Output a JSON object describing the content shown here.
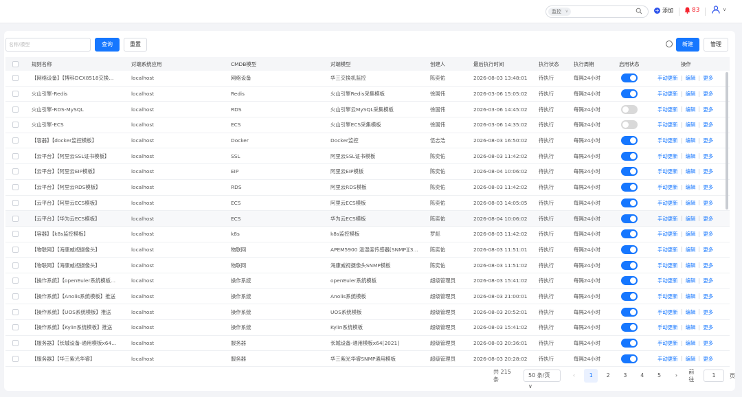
{
  "topbar": {
    "search_select": "监控",
    "add_label": "添加",
    "notification_count": "83"
  },
  "toolbar": {
    "name_placeholder": "名称/模型",
    "query_label": "查询",
    "reset_label": "重置",
    "new_label": "新建",
    "manage_label": "管理"
  },
  "columns": [
    "规则名称",
    "对端系统应用",
    "CMDB模型",
    "对端模型",
    "创建人",
    "最后执行时间",
    "执行状态",
    "执行周期",
    "启用状态",
    "操作"
  ],
  "ops": {
    "update": "手动更新",
    "edit": "编辑",
    "more": "更多"
  },
  "rows": [
    {
      "name": "【网络设备】【博科DCX8518交换...",
      "app": "localhost",
      "cmdb": "网络设备",
      "model": "华三交换机监控",
      "creator": "陈奕佑",
      "time": "2026-08-03 13:48:01",
      "status": "待执行",
      "cycle": "每隔24小时",
      "enabled": true
    },
    {
      "name": "火山引擎-Redis",
      "app": "localhost",
      "cmdb": "Redis",
      "model": "火山引擎Redis采集模板",
      "creator": "徐国伟",
      "time": "2026-03-06 15:05:02",
      "status": "待执行",
      "cycle": "每隔24小时",
      "enabled": true
    },
    {
      "name": "火山引擎-RDS-MySQL",
      "app": "localhost",
      "cmdb": "RDS",
      "model": "火山引擎云MySQL采集模板",
      "creator": "徐国伟",
      "time": "2026-03-06 14:45:02",
      "status": "待执行",
      "cycle": "每隔24小时",
      "enabled": false
    },
    {
      "name": "火山引擎-ECS",
      "app": "localhost",
      "cmdb": "ECS",
      "model": "火山引擎ECS采集模板",
      "creator": "徐国伟",
      "time": "2026-03-06 14:35:02",
      "status": "待执行",
      "cycle": "每隔24小时",
      "enabled": false
    },
    {
      "name": "【容器】【docker监控模板】",
      "app": "localhost",
      "cmdb": "Docker",
      "model": "Docker监控",
      "creator": "伍志浩",
      "time": "2026-08-03 16:50:02",
      "status": "待执行",
      "cycle": "每隔24小时",
      "enabled": true
    },
    {
      "name": "【云平台】【阿里云SSL证书模板】",
      "app": "localhost",
      "cmdb": "SSL",
      "model": "阿里云SSL证书模板",
      "creator": "陈奕佑",
      "time": "2026-08-03 11:42:02",
      "status": "待执行",
      "cycle": "每隔24小时",
      "enabled": true
    },
    {
      "name": "【云平台】【阿里云EIP模板】",
      "app": "localhost",
      "cmdb": "EIP",
      "model": "阿里云EIP模板",
      "creator": "陈奕佑",
      "time": "2026-08-04 10:06:02",
      "status": "待执行",
      "cycle": "每隔24小时",
      "enabled": true
    },
    {
      "name": "【云平台】【阿里云RDS模板】",
      "app": "localhost",
      "cmdb": "RDS",
      "model": "阿里云RDS模板",
      "creator": "陈奕佑",
      "time": "2026-08-03 11:42:02",
      "status": "待执行",
      "cycle": "每隔24小时",
      "enabled": true
    },
    {
      "name": "【云平台】【阿里云ECS模板】",
      "app": "localhost",
      "cmdb": "ECS",
      "model": "阿里云ECS模板",
      "creator": "陈奕佑",
      "time": "2026-08-03 14:05:05",
      "status": "待执行",
      "cycle": "每隔24小时",
      "enabled": true
    },
    {
      "name": "【云平台】【华为云ECS模板】",
      "app": "localhost",
      "cmdb": "ECS",
      "model": "华为云ECS模板",
      "creator": "陈奕佑",
      "time": "2026-08-04 10:06:02",
      "status": "待执行",
      "cycle": "每隔24小时",
      "enabled": true,
      "hl": true
    },
    {
      "name": "【容器】【k8s监控模板】",
      "app": "localhost",
      "cmdb": "k8s",
      "model": "k8s监控模板",
      "creator": "罗彪",
      "time": "2026-08-03 11:42:02",
      "status": "待执行",
      "cycle": "每隔24小时",
      "enabled": true
    },
    {
      "name": "【物联网】【海康威视摄像头】",
      "app": "localhost",
      "cmdb": "物联网",
      "model": "APEM5900 温湿度传感器[SNMP][3...",
      "creator": "陈奕佑",
      "time": "2026-08-03 11:51:01",
      "status": "待执行",
      "cycle": "每隔24小时",
      "enabled": true
    },
    {
      "name": "【物联网】【海康威视摄像头】",
      "app": "localhost",
      "cmdb": "物联网",
      "model": "海康威视摄像头SNMP模板",
      "creator": "陈奕佑",
      "time": "2026-08-03 11:51:02",
      "status": "待执行",
      "cycle": "每隔24小时",
      "enabled": true
    },
    {
      "name": "【操作系统】【openEuler系统模板...",
      "app": "localhost",
      "cmdb": "操作系统",
      "model": "openEuler系统模板",
      "creator": "超级管理员",
      "time": "2026-08-03 15:41:02",
      "status": "待执行",
      "cycle": "每隔24小时",
      "enabled": true
    },
    {
      "name": "【操作系统】【Anolis系统模板】推送",
      "app": "localhost",
      "cmdb": "操作系统",
      "model": "Anolis系统模板",
      "creator": "超级管理员",
      "time": "2026-08-03 21:00:01",
      "status": "待执行",
      "cycle": "每隔24小时",
      "enabled": true
    },
    {
      "name": "【操作系统】【UOS系统模板】推送",
      "app": "localhost",
      "cmdb": "操作系统",
      "model": "UOS系统模板",
      "creator": "超级管理员",
      "time": "2026-08-03 20:52:01",
      "status": "待执行",
      "cycle": "每隔24小时",
      "enabled": true
    },
    {
      "name": "【操作系统】【Kylin系统模板】推送",
      "app": "localhost",
      "cmdb": "操作系统",
      "model": "Kylin系统模板",
      "creator": "超级管理员",
      "time": "2026-08-03 15:41:02",
      "status": "待执行",
      "cycle": "每隔24小时",
      "enabled": true
    },
    {
      "name": "【服务器】【长城设备-通用模板x64...",
      "app": "localhost",
      "cmdb": "服务器",
      "model": "长城设备-通用模板x64[2021]",
      "creator": "超级管理员",
      "time": "2026-08-03 20:36:01",
      "status": "待执行",
      "cycle": "每隔24小时",
      "enabled": true
    },
    {
      "name": "【服务器】【华三紫光华睿】",
      "app": "localhost",
      "cmdb": "服务器",
      "model": "华三紫光华睿SNMP通用模板",
      "creator": "超级管理员",
      "time": "2026-08-03 20:28:02",
      "status": "待执行",
      "cycle": "每隔24小时",
      "enabled": true
    }
  ],
  "pagination": {
    "total": "共 215 条",
    "page_size": "50 条/页",
    "pages": [
      "1",
      "2",
      "3",
      "4",
      "5"
    ],
    "current": "1",
    "goto_label": "前往",
    "goto_value": "1",
    "page_unit": "页"
  }
}
